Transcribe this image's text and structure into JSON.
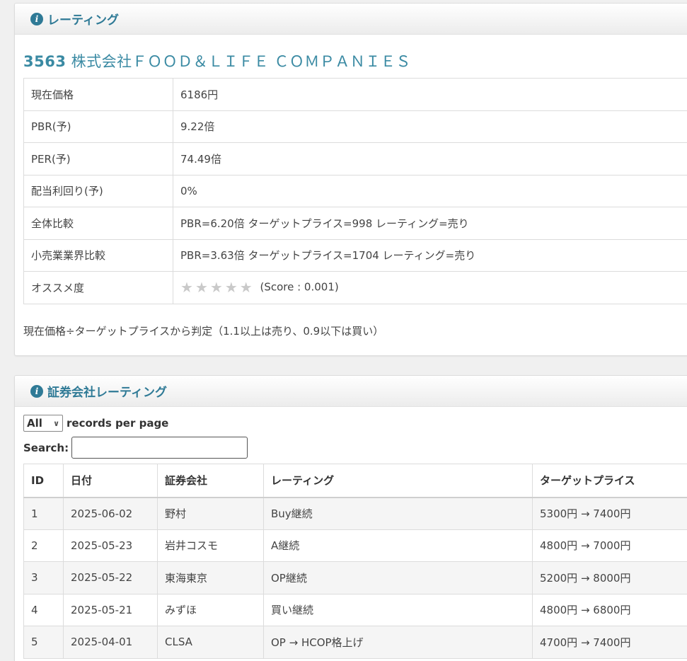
{
  "rating_panel": {
    "title": "レーティング",
    "company_code": "3563",
    "company_name": "株式会社ＦＯＯＤ＆ＬＩＦＥ ＣＯＭＰＡＮＩＥＳ",
    "rows": [
      {
        "label": "現在価格",
        "value": "6186円"
      },
      {
        "label": "PBR(予)",
        "value": "9.22倍"
      },
      {
        "label": "PER(予)",
        "value": "74.49倍"
      },
      {
        "label": "配当利回り(予)",
        "value": "0%"
      },
      {
        "label": "全体比較",
        "value": "PBR=6.20倍  ターゲットプライス=998  レーティング=売り"
      },
      {
        "label": "小売業業界比較",
        "value": "PBR=3.63倍  ターゲットプライス=1704  レーティング=売り"
      }
    ],
    "recommend": {
      "label": "オススメ度",
      "stars_filled": 0,
      "stars_total": 5,
      "score_text": "(Score : 0.001)"
    },
    "note": "現在価格÷ターゲットプライスから判定（1.1以上は売り、0.9以下は買い）"
  },
  "broker_panel": {
    "title": "証券会社レーティング",
    "length_value": "All",
    "length_label": "records per page",
    "search_label": "Search:",
    "search_value": "",
    "columns": [
      "ID",
      "日付",
      "証券会社",
      "レーティング",
      "ターゲットプライス"
    ],
    "rows": [
      [
        "1",
        "2025-06-02",
        "野村",
        "Buy継続",
        "5300円 → 7400円"
      ],
      [
        "2",
        "2025-05-23",
        "岩井コスモ",
        "A継続",
        "4800円 → 7000円"
      ],
      [
        "3",
        "2025-05-22",
        "東海東京",
        "OP継続",
        "5200円 → 8000円"
      ],
      [
        "4",
        "2025-05-21",
        "みずほ",
        "買い継続",
        "4800円 → 6800円"
      ],
      [
        "5",
        "2025-04-01",
        "CLSA",
        "OP → HCOP格上げ",
        "4700円 → 7400円"
      ]
    ]
  },
  "colors": {
    "accent": "#2f7a96",
    "company": "#3a8aa3",
    "star_empty": "#c9c9c9"
  }
}
